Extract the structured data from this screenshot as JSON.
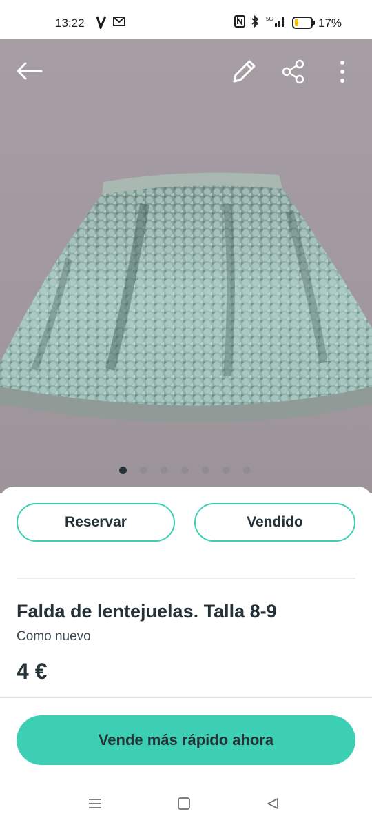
{
  "status_bar": {
    "time": "13:22",
    "battery_percent": "17%",
    "icons": [
      "vodafone-icon",
      "message-icon",
      "nfc-icon",
      "bluetooth-icon",
      "signal-5g-icon",
      "battery-icon"
    ]
  },
  "toolbar": {
    "back_icon": "arrow-left-icon",
    "edit_icon": "pencil-icon",
    "share_icon": "share-icon",
    "more_icon": "more-vertical-icon"
  },
  "gallery": {
    "image_subject": "sequined skirt",
    "total_images": 7,
    "active_index": 0
  },
  "actions": {
    "reserve_label": "Reservar",
    "sold_label": "Vendido"
  },
  "item": {
    "title": "Falda de lentejuelas. Talla 8-9",
    "condition": "Como nuevo",
    "price": "4 €"
  },
  "cta": {
    "label": "Vende más rápido ahora"
  },
  "colors": {
    "accent": "#3ccfb4",
    "text": "#253238"
  },
  "nav_bar": {
    "icons": [
      "menu-icon",
      "home-square-icon",
      "back-triangle-icon"
    ]
  }
}
